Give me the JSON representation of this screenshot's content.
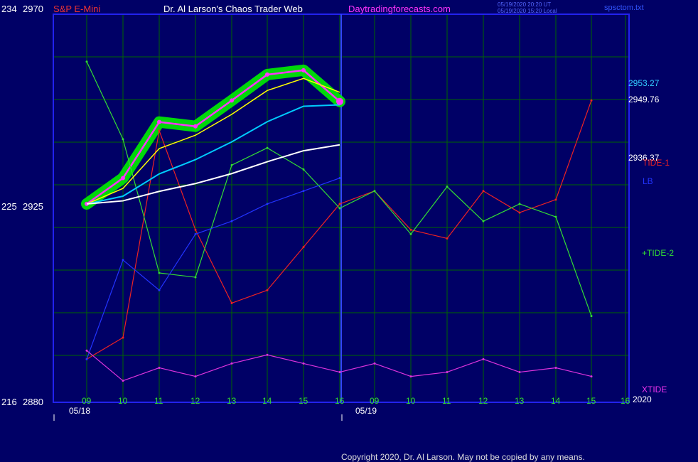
{
  "header": {
    "left_labels": [
      "234",
      "2970"
    ],
    "instrument": "S&P E-Mini",
    "title": "Dr. Al Larson's Chaos Trader Web",
    "site": "Daytradingforecasts.com",
    "timestamp_1": "05/19/2020 20:20 UT",
    "timestamp_2": "05/19/2020 15:20 Local",
    "file": "spsctom.txt"
  },
  "y_labels": {
    "mid": [
      "225",
      "2925"
    ],
    "bottom": [
      "216",
      "2880"
    ]
  },
  "right_labels": {
    "price_1": "2953.27",
    "price_2": "2949.76",
    "price_3": "2936.37",
    "tide1": "TIDE-1",
    "lb": "LB",
    "tide2": "+TIDE-2",
    "xtide": "XTIDE",
    "year_corner": "2020"
  },
  "x_axis": {
    "hour_ticks": [
      "09",
      "10",
      "11",
      "12",
      "13",
      "14",
      "15",
      "16",
      "09",
      "10",
      "11",
      "12",
      "13",
      "14",
      "15",
      "16"
    ],
    "dates": [
      "05/18",
      "05/19"
    ]
  },
  "footer": {
    "copyright": "Copyright 2020, Dr. Al Larson. May not be copied by any means."
  },
  "colors": {
    "background": "#000066",
    "frame": "#2222ee",
    "grid": "#006600",
    "price_bars": "#ff33ff",
    "glow": "#00ee00",
    "ema_short": "#ffff00",
    "ema_mid": "#00ccff",
    "ema_long": "#ffffff",
    "tide1": "#ee2222",
    "tide2": "#33dd33",
    "lb": "#2233ff",
    "xtide": "#dd33dd"
  },
  "chart_data": {
    "type": "line",
    "title": "S&P E-Mini",
    "ylim": [
      2880,
      2970
    ],
    "x": [
      "05/18 09",
      "05/18 10",
      "05/18 11",
      "05/18 12",
      "05/18 13",
      "05/18 14",
      "05/18 15",
      "05/18 16",
      "05/19 09",
      "05/19 10",
      "05/19 11",
      "05/19 12",
      "05/19 13",
      "05/19 14",
      "05/19 15"
    ],
    "series": [
      {
        "name": "Price",
        "values": [
          2926,
          2932,
          2945,
          2944,
          2950,
          2956,
          2957,
          2949.76,
          null,
          null,
          null,
          null,
          null,
          null,
          null
        ]
      },
      {
        "name": "TIDE-1",
        "values": [
          2890,
          2895,
          2943,
          2920,
          2903,
          2906,
          2916,
          2926,
          2929,
          2920,
          2918,
          2929,
          2924,
          2927,
          2950
        ]
      },
      {
        "name": "+TIDE-2",
        "values": [
          2959,
          2941,
          2910,
          2909,
          2935,
          2939,
          2934,
          2925,
          2929,
          2919,
          2930,
          2922,
          2926,
          2923,
          2900
        ]
      },
      {
        "name": "LB",
        "values": [
          2890,
          2913,
          2906,
          2919,
          2922,
          2926,
          2929,
          2932,
          null,
          null,
          null,
          null,
          null,
          null,
          null
        ]
      },
      {
        "name": "XTIDE",
        "values": [
          2892,
          2885,
          2888,
          2886,
          2889,
          2891,
          2889,
          2887,
          2889,
          2886,
          2887,
          2890,
          2887,
          2888,
          2886
        ]
      }
    ],
    "right_price_labels": [
      2953.27,
      2949.76,
      2936.37
    ]
  }
}
